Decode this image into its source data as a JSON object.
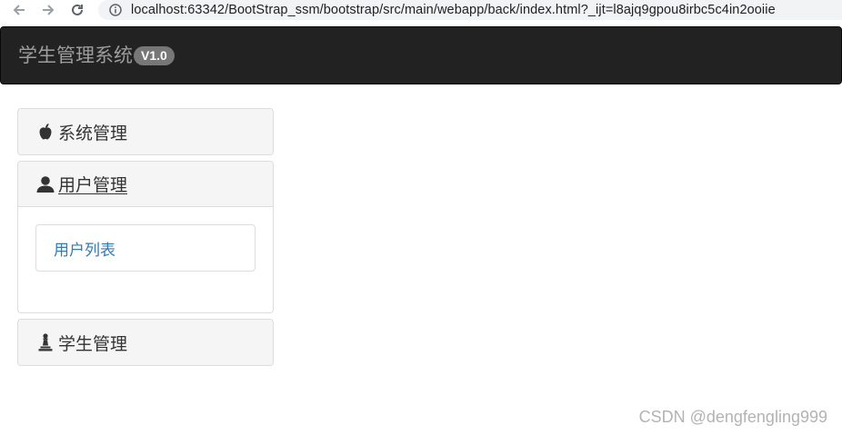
{
  "browser": {
    "url": "localhost:63342/BootStrap_ssm/bootstrap/src/main/webapp/back/index.html?_ijt=l8ajq9gpou8irbc5c4in2ooiie",
    "icons": [
      "back-arrow-icon",
      "forward-arrow-icon",
      "reload-icon",
      "info-icon"
    ]
  },
  "navbar": {
    "brand": "学生管理系统",
    "version_badge": "V1.0",
    "background_color": "#222222"
  },
  "accordion": {
    "panels": [
      {
        "title": "系统管理",
        "icon": "apple-icon",
        "expanded": false
      },
      {
        "title": "用户管理",
        "icon": "user-icon",
        "expanded": true,
        "items": [
          "用户列表"
        ]
      },
      {
        "title": "学生管理",
        "icon": "pawn-icon",
        "expanded": false
      }
    ],
    "link_color": "#337ab7"
  },
  "watermark": "CSDN @dengfengling999"
}
